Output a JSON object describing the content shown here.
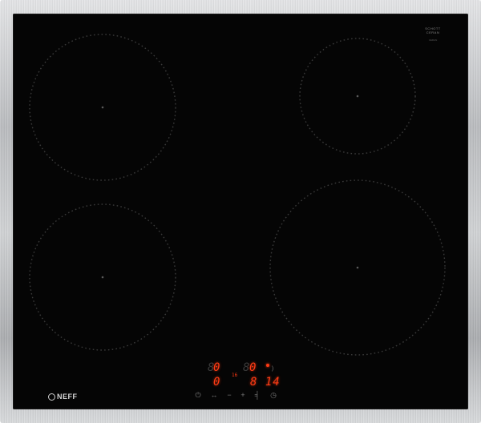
{
  "brand": {
    "logo_text": "NEFF",
    "glass_maker_line1": "SCHOTT",
    "glass_maker_line2": "CERAN",
    "glass_small_line1": "CERAN",
    "glass_small_line2": ""
  },
  "zones": [
    {
      "id": "rear-left",
      "shape": "circle"
    },
    {
      "id": "rear-right",
      "shape": "circle"
    },
    {
      "id": "front-left",
      "shape": "circle"
    },
    {
      "id": "front-right",
      "shape": "circle"
    }
  ],
  "display": {
    "zone_left_top": "0",
    "zone_right_top": "0",
    "zone_left_bottom": "0",
    "timer": "8 14",
    "center_label": "16",
    "dim_placeholder": "8"
  },
  "controls": [
    {
      "id": "power",
      "icon": "power-icon",
      "glyph": "⏻"
    },
    {
      "id": "lock",
      "icon": "child-lock-icon",
      "glyph": "↔"
    },
    {
      "id": "minus",
      "icon": "minus-icon",
      "glyph": "−"
    },
    {
      "id": "plus",
      "icon": "plus-icon",
      "glyph": "+"
    },
    {
      "id": "zone-select",
      "icon": "zone-select-icon",
      "glyph": "╡"
    },
    {
      "id": "timer",
      "icon": "timer-icon",
      "glyph": "◷"
    }
  ],
  "colors": {
    "glass": "#050505",
    "frame": "#c0c2c5",
    "led": "#ff3b14",
    "zone_outline": "#3a3a3a"
  }
}
